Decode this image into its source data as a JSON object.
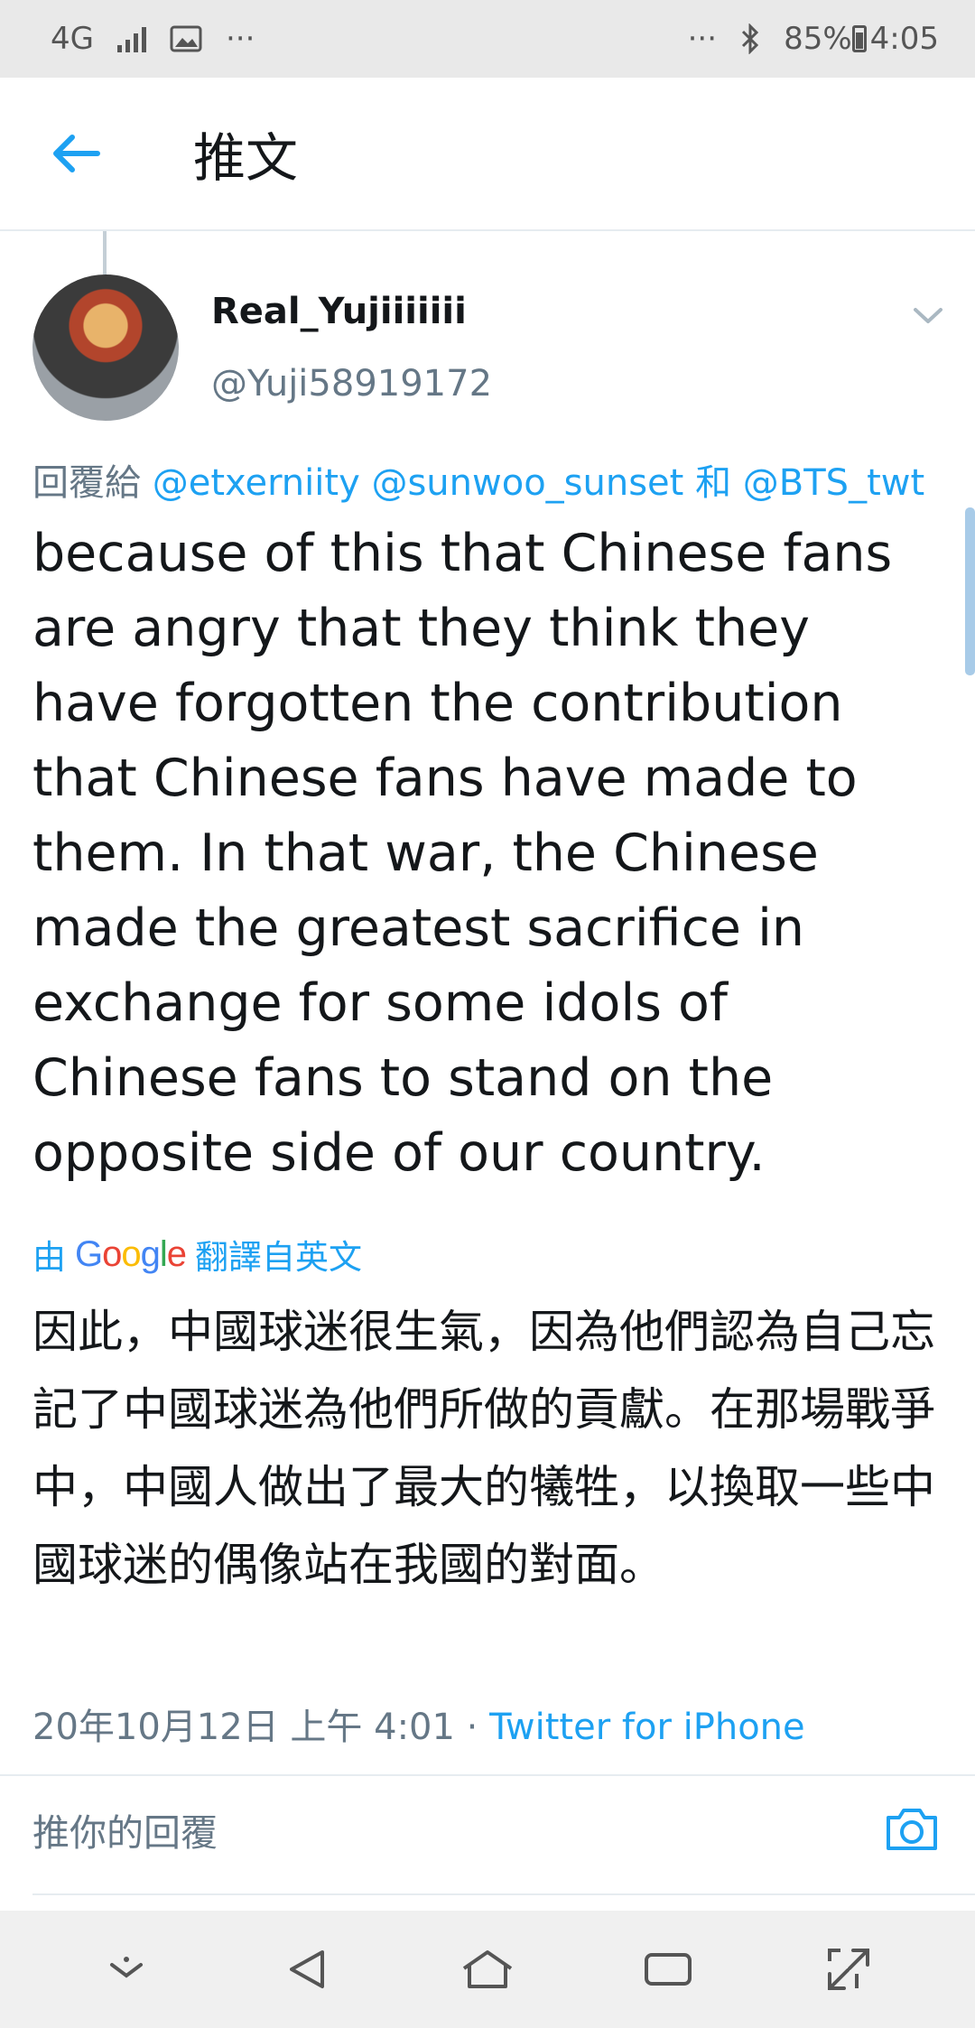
{
  "status_bar": {
    "network": "4G",
    "left_dots": "···",
    "right_dots": "···",
    "battery": "85%",
    "time": "4:05"
  },
  "header": {
    "title": "推文"
  },
  "tweet": {
    "display_name": "Real_Yujiiiiiii",
    "handle": "@Yuji58919172",
    "reply_prefix": "回覆給",
    "mention_1": "@etxerniity",
    "mention_2": "@sunwoo_sunset",
    "reply_conj": "和",
    "mention_3": "@BTS_twt",
    "text": "because of this that Chinese fans are angry that they think they have forgotten the contribution that Chinese fans have made to them. In that war, the Chinese made the greatest sacrifice in exchange for some idols of Chinese fans to stand on the opposite side of our country.",
    "translate_by": "由",
    "translate_provider": "Google",
    "translate_suffix": "翻譯自英文",
    "translated_text": "因此，中國球迷很生氣，因為他們認為自己忘記了中國球迷為他們所做的貢獻。在那場戰爭中，中國人做出了最大的犧牲，以換取一些中國球迷的偶像站在我國的對面。",
    "timestamp": "20年10月12日 上午 4:01",
    "separator": "·",
    "source": "Twitter for iPhone"
  },
  "reply": {
    "placeholder": "推你的回覆"
  },
  "colors": {
    "accent": "#1da1f2",
    "secondary_text": "#657786",
    "primary_text": "#14171a"
  }
}
